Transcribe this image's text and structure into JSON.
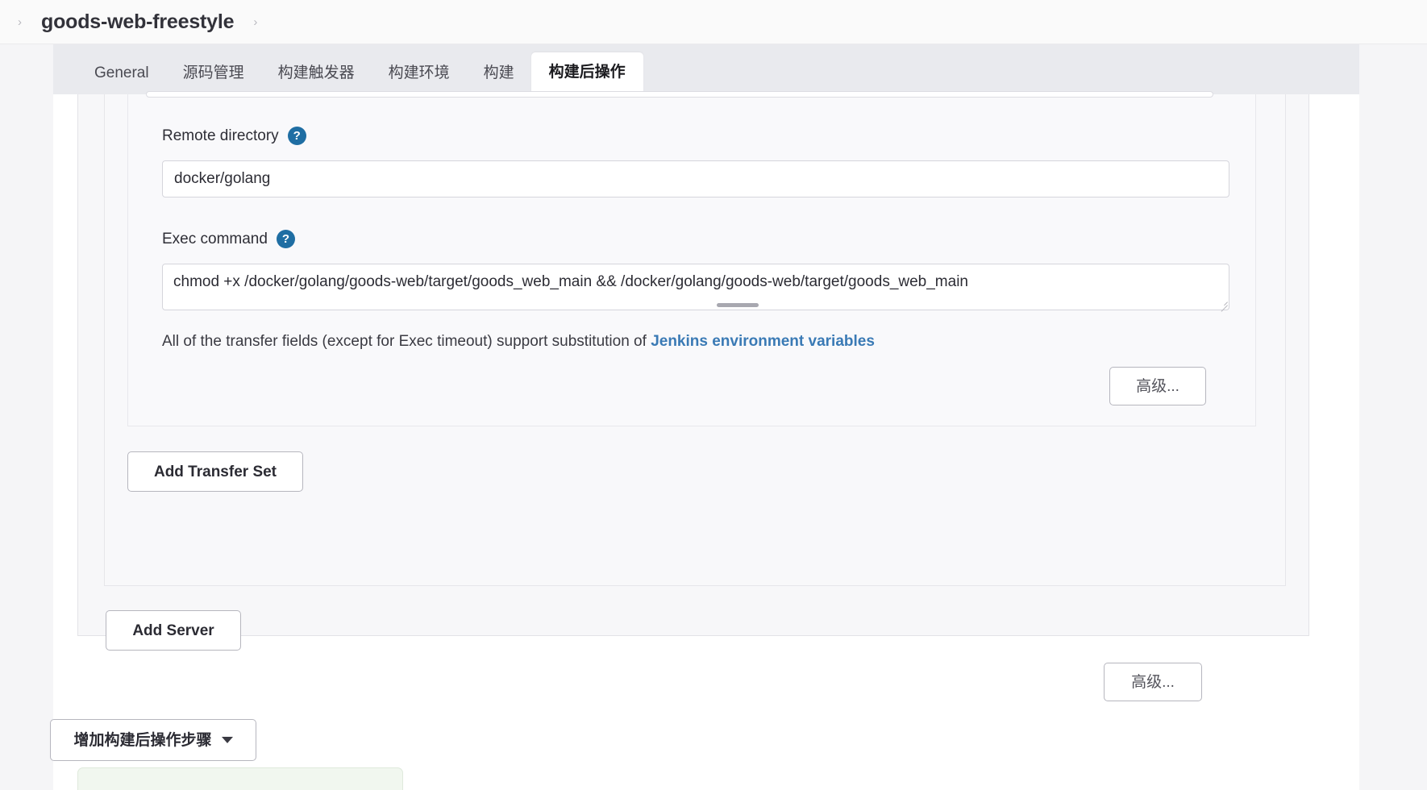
{
  "breadcrumb": {
    "leading_caret": "›",
    "job_name": "goods-web-freestyle",
    "trailing_caret": "›"
  },
  "tabs": [
    {
      "label": "General",
      "active": false
    },
    {
      "label": "源码管理",
      "active": false
    },
    {
      "label": "构建触发器",
      "active": false
    },
    {
      "label": "构建环境",
      "active": false
    },
    {
      "label": "构建",
      "active": false
    },
    {
      "label": "构建后操作",
      "active": true
    }
  ],
  "form": {
    "remote_directory": {
      "label": "Remote directory",
      "help": "?",
      "value": "docker/golang",
      "placeholder": ""
    },
    "exec_command": {
      "label": "Exec command",
      "help": "?",
      "value": "chmod +x /docker/golang/goods-web/target/goods_web_main && /docker/golang/goods-web/target/goods_web_main",
      "placeholder": ""
    },
    "note": {
      "prefix": "All of the transfer fields (except for Exec timeout) support substitution of ",
      "link_text": "Jenkins environment variables"
    }
  },
  "buttons": {
    "advanced_transfer": "高级...",
    "add_transfer_set": "Add Transfer Set",
    "add_server": "Add Server",
    "advanced_server": "高级...",
    "add_postbuild_step": "增加构建后操作步骤"
  },
  "colors": {
    "help_icon": "#1f6ea3",
    "link": "#3a7ab5",
    "tab_strip": "#e9eaee",
    "active_tab": "#ffffff"
  }
}
